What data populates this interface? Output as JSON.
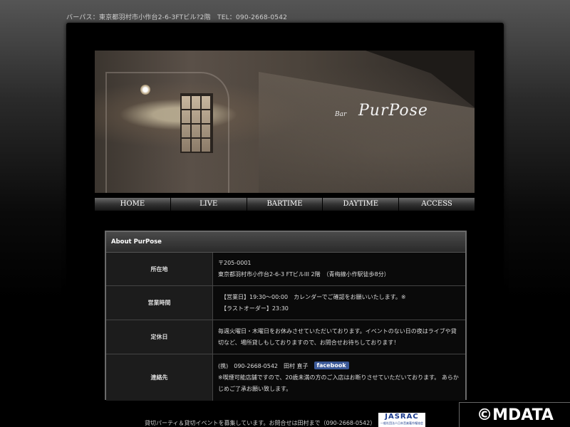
{
  "top_address": "バーパス：東京都羽村市小作台2-6-3FTビル?2階　TEL：090-2668-0542",
  "hero": {
    "logo_small": "Bar",
    "logo_main": "PurPose"
  },
  "nav": {
    "items": [
      "HOME",
      "LIVE",
      "BARTIME",
      "DAYTIME",
      "ACCESS"
    ]
  },
  "about": {
    "title": "About PurPose",
    "rows": [
      {
        "label": "所在地",
        "lines": [
          "〒205-0001",
          "東京都羽村市小作台2-6-3 FTビルIII 2階　（青梅線小作駅徒歩8分）"
        ]
      },
      {
        "label": "営業時間",
        "lines": [
          "　【営業日】19:30〜00:00　カレンダーでご確認をお願いいたします。※",
          "　【ラストオーダー】23:30"
        ]
      },
      {
        "label": "定休日",
        "lines": [
          "毎週火曜日・木曜日をお休みさせていただいております。イベントのない日の夜はライブや貸",
          "切など、場所貸しもしておりますので、お問合せお待ちしております！"
        ]
      },
      {
        "label": "連絡先",
        "phone_line": "(携)　090-2668-0542　田村 直子",
        "facebook_label": "facebook",
        "lines": [
          "※喫煙可能店舗ですので、20歳未満の方のご入店はお断りさせていただいております。 あらか",
          "じめご了承お願い致します。"
        ]
      }
    ]
  },
  "footer": {
    "note": "貸切パーティ＆貸切イベントを募集しています。お問合せは田村まで（090-2668-0542）",
    "jasrac_main": "JASRAC",
    "jasrac_sub": "一般社団法人日本音楽著作権協会"
  },
  "watermark": "©MDATA"
}
